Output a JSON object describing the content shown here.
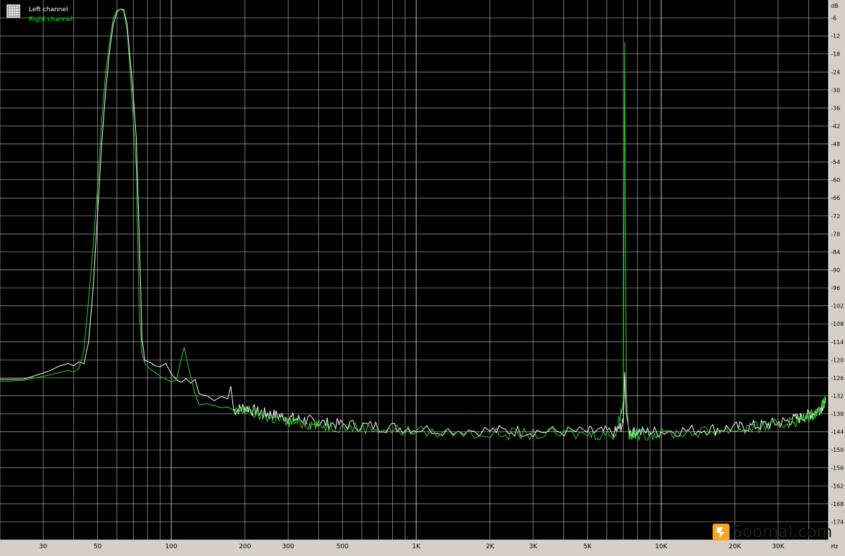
{
  "colors": {
    "background": "#000000",
    "grid": "#a8a8a8",
    "grid_major": "#c8c8c8",
    "axis_panel": "#d4d0c8",
    "left_channel": "#ffffff",
    "right_channel": "#2fd02f",
    "watermark_accent": "#f5a623"
  },
  "legend": {
    "icon": "grid-icon",
    "left_channel": "Left channel",
    "right_channel": "Right channel"
  },
  "watermark": {
    "icon": "soomal-logo-icon",
    "text": "Soomal.com"
  },
  "chart_data": {
    "type": "line",
    "x_scale": "log",
    "xlim": [
      20,
      48000
    ],
    "ylim": [
      -180,
      0
    ],
    "xunit": "Hz",
    "yunit": "dB",
    "grid": true,
    "legend_position": "top-left",
    "x_ticks": [
      {
        "value": 30,
        "label": "30"
      },
      {
        "value": 50,
        "label": "50"
      },
      {
        "value": 100,
        "label": "100"
      },
      {
        "value": 200,
        "label": "200"
      },
      {
        "value": 300,
        "label": "300"
      },
      {
        "value": 500,
        "label": "500"
      },
      {
        "value": 1000,
        "label": "1K"
      },
      {
        "value": 2000,
        "label": "2K"
      },
      {
        "value": 3000,
        "label": "3K"
      },
      {
        "value": 5000,
        "label": "5K"
      },
      {
        "value": 10000,
        "label": "10K"
      },
      {
        "value": 20000,
        "label": "20K"
      },
      {
        "value": 30000,
        "label": "30K"
      }
    ],
    "y_ticks": [
      -6,
      -12,
      -18,
      -24,
      -30,
      -36,
      -42,
      -48,
      -54,
      -60,
      -66,
      -72,
      -78,
      -84,
      -90,
      -96,
      -102,
      -108,
      -114,
      -120,
      -126,
      -132,
      -138,
      -144,
      -150,
      -156,
      -162,
      -168,
      -174
    ],
    "series": [
      {
        "name": "Left channel",
        "points": [
          [
            20,
            -126.5
          ],
          [
            25,
            -126.4
          ],
          [
            28,
            -125.2
          ],
          [
            32,
            -123.6
          ],
          [
            35,
            -122.0
          ],
          [
            38,
            -121.2
          ],
          [
            40,
            -122.0
          ],
          [
            42,
            -120.6
          ],
          [
            44,
            -121.3
          ],
          [
            46,
            -114
          ],
          [
            48,
            -96
          ],
          [
            50,
            -72
          ],
          [
            52,
            -48
          ],
          [
            54,
            -30
          ],
          [
            56,
            -17
          ],
          [
            58,
            -8
          ],
          [
            60,
            -4
          ],
          [
            62,
            -3
          ],
          [
            64,
            -3.2
          ],
          [
            66,
            -8
          ],
          [
            68,
            -20
          ],
          [
            70,
            -32
          ],
          [
            72,
            -46
          ],
          [
            74,
            -79
          ],
          [
            76,
            -113
          ],
          [
            78,
            -120.2
          ],
          [
            82,
            -120.8
          ],
          [
            86,
            -122.0
          ],
          [
            90,
            -122.3
          ],
          [
            95,
            -121.2
          ],
          [
            100,
            -124.6
          ],
          [
            105,
            -126.6
          ],
          [
            110,
            -127.5
          ],
          [
            115,
            -126.2
          ],
          [
            120,
            -127.8
          ],
          [
            125,
            -126.5
          ],
          [
            130,
            -131.3
          ],
          [
            140,
            -132.0
          ],
          [
            150,
            -133.6
          ],
          [
            160,
            -132.2
          ],
          [
            170,
            -133.0
          ],
          [
            175,
            -128.8
          ],
          [
            180,
            -136.5
          ],
          [
            200,
            -135.4
          ],
          [
            230,
            -137.2
          ],
          [
            260,
            -137.8
          ],
          [
            300,
            -138.9
          ],
          [
            350,
            -139.6
          ],
          [
            400,
            -140.5
          ],
          [
            500,
            -141.1
          ],
          [
            700,
            -141.8
          ],
          [
            1000,
            -142.6
          ],
          [
            2000,
            -143.2
          ],
          [
            3000,
            -143.4
          ],
          [
            5000,
            -143.6
          ],
          [
            6500,
            -143.6
          ],
          [
            7000,
            -141
          ],
          [
            7100,
            -124
          ],
          [
            7200,
            -138
          ],
          [
            7400,
            -143.8
          ],
          [
            8000,
            -143.7
          ],
          [
            10000,
            -143.5
          ],
          [
            15000,
            -142.8
          ],
          [
            20000,
            -142.2
          ],
          [
            25000,
            -141.5
          ],
          [
            30000,
            -140.6
          ],
          [
            35000,
            -139.4
          ],
          [
            40000,
            -138.1
          ],
          [
            44000,
            -136.2
          ],
          [
            47000,
            -133.6
          ]
        ]
      },
      {
        "name": "Right channel",
        "points": [
          [
            20,
            -127.2
          ],
          [
            25,
            -126.8
          ],
          [
            28,
            -126.0
          ],
          [
            32,
            -125.0
          ],
          [
            35,
            -124.2
          ],
          [
            38,
            -123.5
          ],
          [
            40,
            -124.1
          ],
          [
            42,
            -122.8
          ],
          [
            44,
            -117
          ],
          [
            46,
            -100
          ],
          [
            48,
            -82
          ],
          [
            50,
            -63
          ],
          [
            52,
            -40
          ],
          [
            54,
            -24
          ],
          [
            56,
            -14
          ],
          [
            58,
            -6
          ],
          [
            60,
            -3.5
          ],
          [
            62,
            -3
          ],
          [
            64,
            -3.8
          ],
          [
            66,
            -10
          ],
          [
            68,
            -24
          ],
          [
            70,
            -40
          ],
          [
            72,
            -56
          ],
          [
            74,
            -104
          ],
          [
            76,
            -118
          ],
          [
            78,
            -121.3
          ],
          [
            82,
            -123.0
          ],
          [
            86,
            -124.2
          ],
          [
            90,
            -125.5
          ],
          [
            95,
            -126.4
          ],
          [
            100,
            -127.3
          ],
          [
            105,
            -126.8
          ],
          [
            110,
            -119.4
          ],
          [
            113,
            -115.8
          ],
          [
            116,
            -120.2
          ],
          [
            120,
            -125.5
          ],
          [
            125,
            -131.2
          ],
          [
            130,
            -135.0
          ],
          [
            140,
            -134.6
          ],
          [
            150,
            -135.3
          ],
          [
            160,
            -136.0
          ],
          [
            170,
            -135.7
          ],
          [
            180,
            -137.4
          ],
          [
            200,
            -136.2
          ],
          [
            230,
            -138.0
          ],
          [
            260,
            -139.2
          ],
          [
            300,
            -140.2
          ],
          [
            350,
            -140.8
          ],
          [
            400,
            -141.4
          ],
          [
            500,
            -141.9
          ],
          [
            700,
            -142.6
          ],
          [
            1000,
            -143.5
          ],
          [
            2000,
            -144.2
          ],
          [
            3000,
            -144.4
          ],
          [
            5000,
            -144.4
          ],
          [
            6500,
            -144.4
          ],
          [
            7000,
            -134
          ],
          [
            7100,
            -14
          ],
          [
            7200,
            -131
          ],
          [
            7400,
            -144.5
          ],
          [
            8000,
            -144.4
          ],
          [
            10000,
            -144.2
          ],
          [
            15000,
            -143.6
          ],
          [
            20000,
            -142.9
          ],
          [
            25000,
            -142.1
          ],
          [
            30000,
            -141.3
          ],
          [
            35000,
            -140.1
          ],
          [
            40000,
            -138.6
          ],
          [
            44000,
            -136.5
          ],
          [
            47000,
            -133.0
          ]
        ]
      }
    ]
  }
}
